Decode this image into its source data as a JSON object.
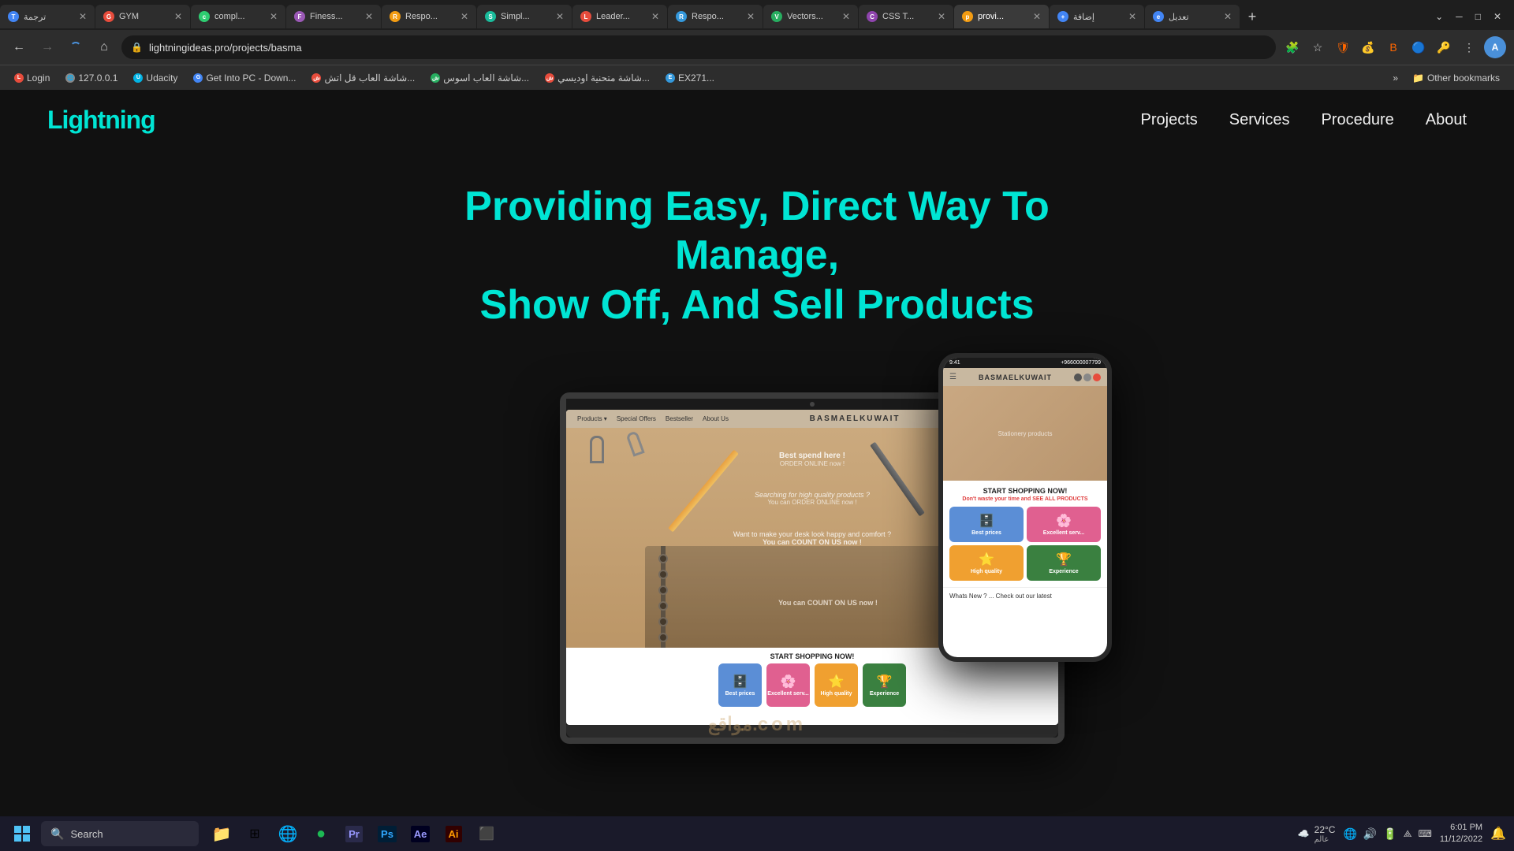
{
  "browser": {
    "tabs": [
      {
        "id": 1,
        "label": "ترجمة",
        "active": false,
        "favicon_color": "#4285f4"
      },
      {
        "id": 2,
        "label": "GYM",
        "active": false,
        "favicon_color": "#e74c3c"
      },
      {
        "id": 3,
        "label": "compl...",
        "active": false,
        "favicon_color": "#2ecc71"
      },
      {
        "id": 4,
        "label": "Finess...",
        "active": false,
        "favicon_color": "#9b59b6"
      },
      {
        "id": 5,
        "label": "Respo...",
        "active": false,
        "favicon_color": "#f39c12"
      },
      {
        "id": 6,
        "label": "Simpl...",
        "active": false,
        "favicon_color": "#1abc9c"
      },
      {
        "id": 7,
        "label": "Leader...",
        "active": false,
        "favicon_color": "#e74c3c"
      },
      {
        "id": 8,
        "label": "Respo...",
        "active": false,
        "favicon_color": "#3498db"
      },
      {
        "id": 9,
        "label": "Vectors...",
        "active": false,
        "favicon_color": "#27ae60"
      },
      {
        "id": 10,
        "label": "CSS T...",
        "active": false,
        "favicon_color": "#8e44ad"
      },
      {
        "id": 11,
        "label": "provi...",
        "active": true,
        "favicon_color": "#f39c12"
      },
      {
        "id": 12,
        "label": "إضافة",
        "active": false,
        "favicon_color": "#4285f4"
      },
      {
        "id": 13,
        "label": "تعديل",
        "active": false,
        "favicon_color": "#4285f4"
      }
    ],
    "address": "lightningideas.pro/projects/basma",
    "new_tab_label": "+"
  },
  "bookmarks": [
    {
      "label": "Login",
      "favicon_color": "#e74c3c"
    },
    {
      "label": "127.0.0.1",
      "favicon_color": "#888"
    },
    {
      "label": "Udacity",
      "favicon_color": "#02b3e4"
    },
    {
      "label": "Get Into PC - Down...",
      "favicon_color": "#4285f4"
    },
    {
      "label": "شاشة العاب قل اتش...",
      "favicon_color": "#e74c3c"
    },
    {
      "label": "شاشة العاب اسوس...",
      "favicon_color": "#27ae60"
    },
    {
      "label": "شاشة متحنية اوديسي...",
      "favicon_color": "#e74c3c"
    },
    {
      "label": "EX271...",
      "favicon_color": "#3498db"
    }
  ],
  "site": {
    "logo": "Lightning",
    "nav_links": [
      "Projects",
      "Services",
      "Procedure",
      "About"
    ],
    "hero_title_line1": "Providing Easy, Direct Way To Manage,",
    "hero_title_line2": "Show Off, And Sell Products",
    "laptop_brand": "BASMAELKUWAIT",
    "laptop_nav_links": [
      "Products ▾",
      "Special Offers",
      "Bestseller",
      "About Us"
    ],
    "laptop_shop_cta": "START SHOPPING NOW!",
    "laptop_subtitle": "Don't waste your time and SEE ALL PRODUCTS",
    "laptop_count_on_us": "You can COUNT ON US now!",
    "laptop_make_desk": "Want to make your desk look happy and comfort ?",
    "product_cards": [
      {
        "label": "Best prices",
        "color": "#5b8ed6"
      },
      {
        "label": "Excellent serv...",
        "color": "#e06090"
      },
      {
        "label": "High quality",
        "color": "#f0a030"
      },
      {
        "label": "Experience",
        "color": "#3a8040"
      }
    ],
    "phone_brand": "BASMAELKUWAIT",
    "phone_cta": "START SHOPPING NOW!",
    "phone_subtitle_pre": "Don't waste your time and ",
    "phone_subtitle_link": "SEE ALL PRODUCTS",
    "phone_whats_new": "Whats New ? ... Check out our latest",
    "watermark": "مواقع.com"
  },
  "taskbar": {
    "search_placeholder": "Search",
    "time": "6:01 PM",
    "date": "11/12/2022",
    "weather_temp": "22°C",
    "weather_desc": "عالم",
    "apps": [
      {
        "name": "file-explorer",
        "icon": "📁"
      },
      {
        "name": "taskbar-tiles",
        "icon": "⊞"
      },
      {
        "name": "chrome",
        "icon": "🌐"
      },
      {
        "name": "spotify",
        "icon": "🎵"
      },
      {
        "name": "premiere",
        "icon": "Pr"
      },
      {
        "name": "photoshop",
        "icon": "Ps"
      },
      {
        "name": "ae",
        "icon": "Ae"
      },
      {
        "name": "ai",
        "icon": "Ai"
      },
      {
        "name": "terminal",
        "icon": "⬛"
      }
    ]
  }
}
